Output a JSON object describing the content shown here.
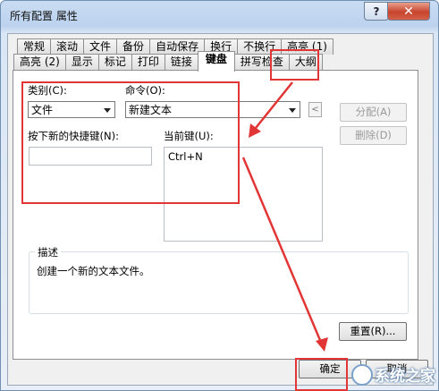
{
  "window": {
    "title": "所有配置 属性",
    "help_symbol": "?",
    "close_symbol": "✕"
  },
  "tabs": {
    "row1": [
      "常规",
      "滚动",
      "文件",
      "备份",
      "自动保存",
      "换行",
      "不换行",
      "高亮 (1)"
    ],
    "row2": [
      "高亮 (2)",
      "显示",
      "标记",
      "打印",
      "链接",
      "键盘",
      "拼写检查",
      "大纲"
    ],
    "active": "键盘"
  },
  "keyboard": {
    "category_label": "类别(C):",
    "category_value": "文件",
    "command_label": "命令(O):",
    "command_value": "新建文本",
    "small_button": "<",
    "assign_button": "分配(A)",
    "delete_button": "删除(D)",
    "new_shortcut_label": "按下新的快捷键(N):",
    "new_shortcut_value": "",
    "current_keys_label": "当前键(U):",
    "current_keys": [
      "Ctrl+N"
    ],
    "description_label": "描述",
    "description_text": "创建一个新的文本文件。",
    "reset_button": "重置(R)..."
  },
  "footer": {
    "ok_button": "确定",
    "cancel_button": "取消"
  },
  "watermark": "系统之家",
  "annotation_color": "#e23636"
}
